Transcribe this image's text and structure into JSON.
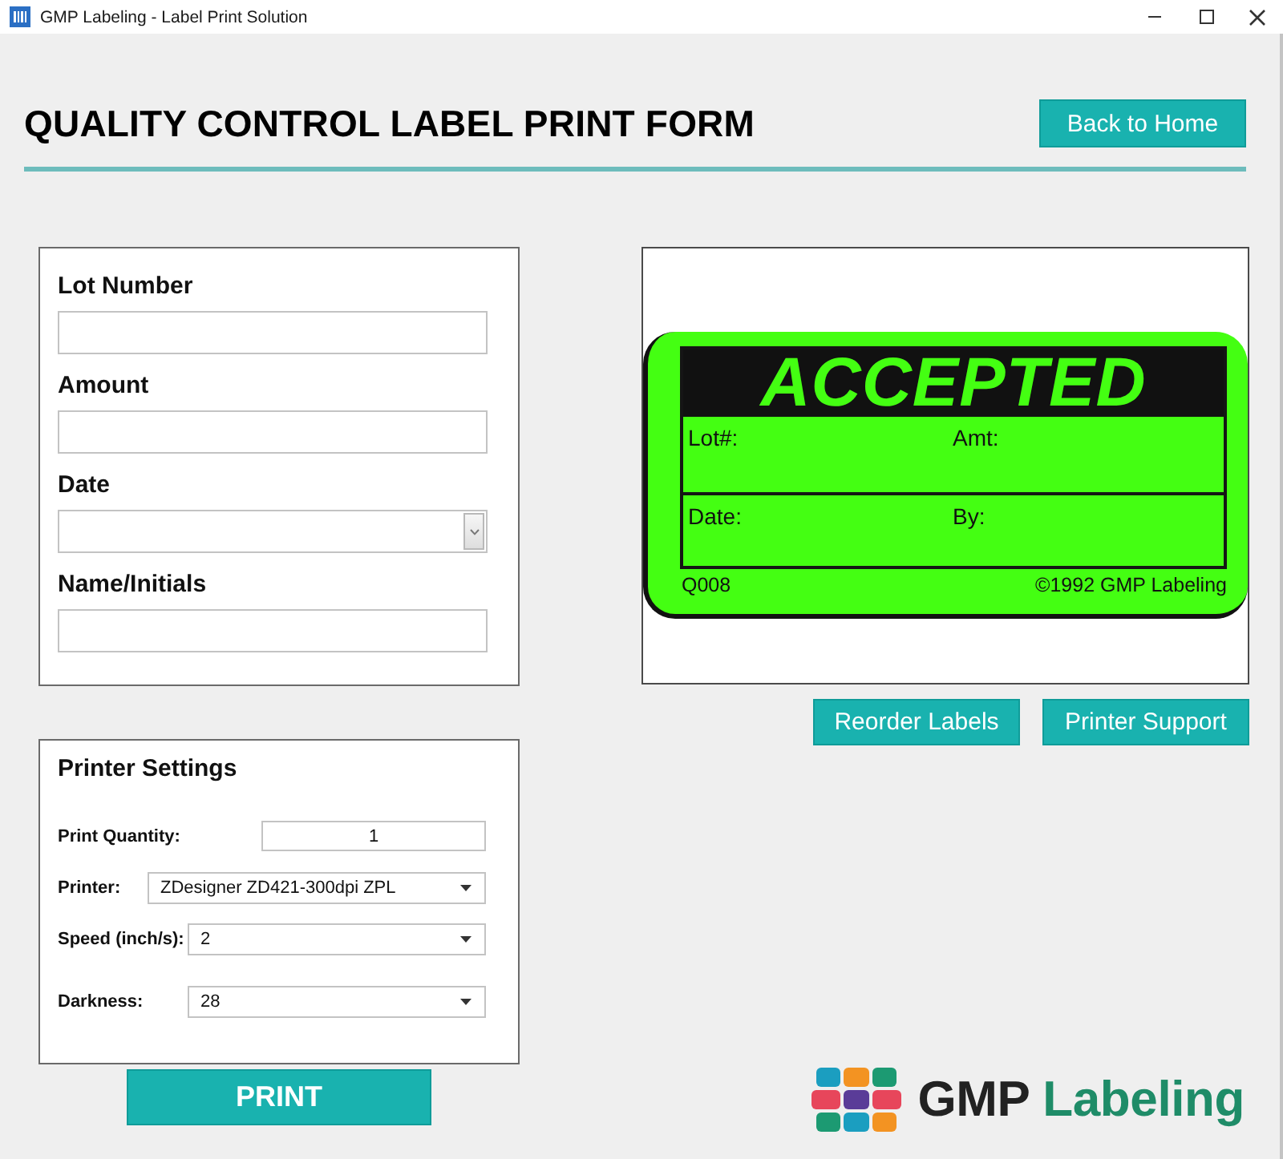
{
  "window": {
    "title": "GMP Labeling - Label Print Solution"
  },
  "header": {
    "title": "QUALITY CONTROL LABEL PRINT FORM",
    "back_button": "Back to Home"
  },
  "form": {
    "fields": [
      {
        "label": "Lot Number",
        "kind": "text"
      },
      {
        "label": "Amount",
        "kind": "text"
      },
      {
        "label": "Date",
        "kind": "date"
      },
      {
        "label": "Name/Initials",
        "kind": "text"
      }
    ]
  },
  "printer_settings": {
    "title": "Printer Settings",
    "rows": [
      {
        "label": "Print Quantity:",
        "kind": "number",
        "value": "1"
      },
      {
        "label": "Printer:",
        "kind": "select",
        "value": "ZDesigner ZD421-300dpi ZPL"
      },
      {
        "label": "Speed (inch/s):",
        "kind": "select",
        "value": "2"
      },
      {
        "label": "Darkness:",
        "kind": "select",
        "value": "28"
      }
    ]
  },
  "print_button": "PRINT",
  "label_preview": {
    "heading": "ACCEPTED",
    "rows": [
      [
        "Lot#:",
        "Amt:"
      ],
      [
        "Date:",
        "By:"
      ]
    ],
    "code": "Q008",
    "copyright": "©1992 GMP Labeling"
  },
  "preview_buttons": [
    "Reorder Labels",
    "Printer Support"
  ],
  "logo": {
    "first_word": "GMP",
    "second_word": "Labeling"
  }
}
